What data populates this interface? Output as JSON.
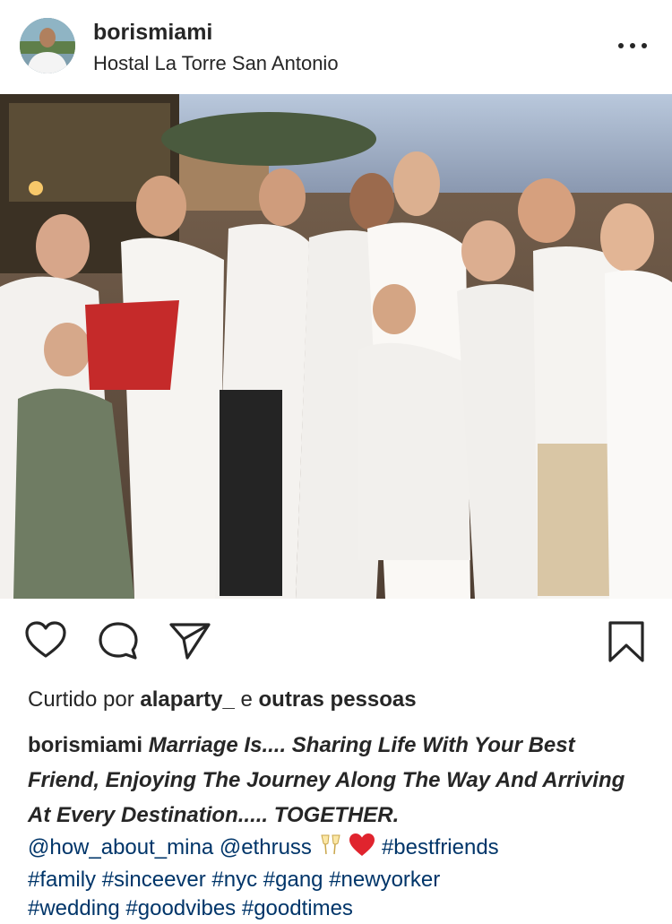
{
  "post": {
    "username": "borismiami",
    "location": "Hostal La Torre San Antonio"
  },
  "likes": {
    "prefix": "Curtido por",
    "user": "alaparty_",
    "connector": "e",
    "rest": "outras pessoas"
  },
  "caption": {
    "username": "borismiami",
    "text": "Marriage Is.... Sharing Life With Your Best Friend, Enjoying The Journey Along The Way And Arriving At Every Destination..... TOGETHER."
  },
  "tags": {
    "mention1": "@how_about_mina",
    "mention2": "@ethruss",
    "hashtags_line1": "#bestfriends",
    "hashtags_line2": "#family #sinceever #nyc #gang #newyorker",
    "hashtags_line3": "#wedding #goodvibes #goodtimes"
  },
  "icons": {
    "more": "more-options-icon",
    "like": "heart-outline-icon",
    "comment": "comment-bubble-icon",
    "share": "paper-plane-icon",
    "save": "bookmark-icon",
    "glasses": "clinking-glasses-emoji",
    "heart": "red-heart-emoji"
  },
  "colors": {
    "text": "#262626",
    "link": "#003569",
    "heart_emoji": "#e0242e"
  }
}
